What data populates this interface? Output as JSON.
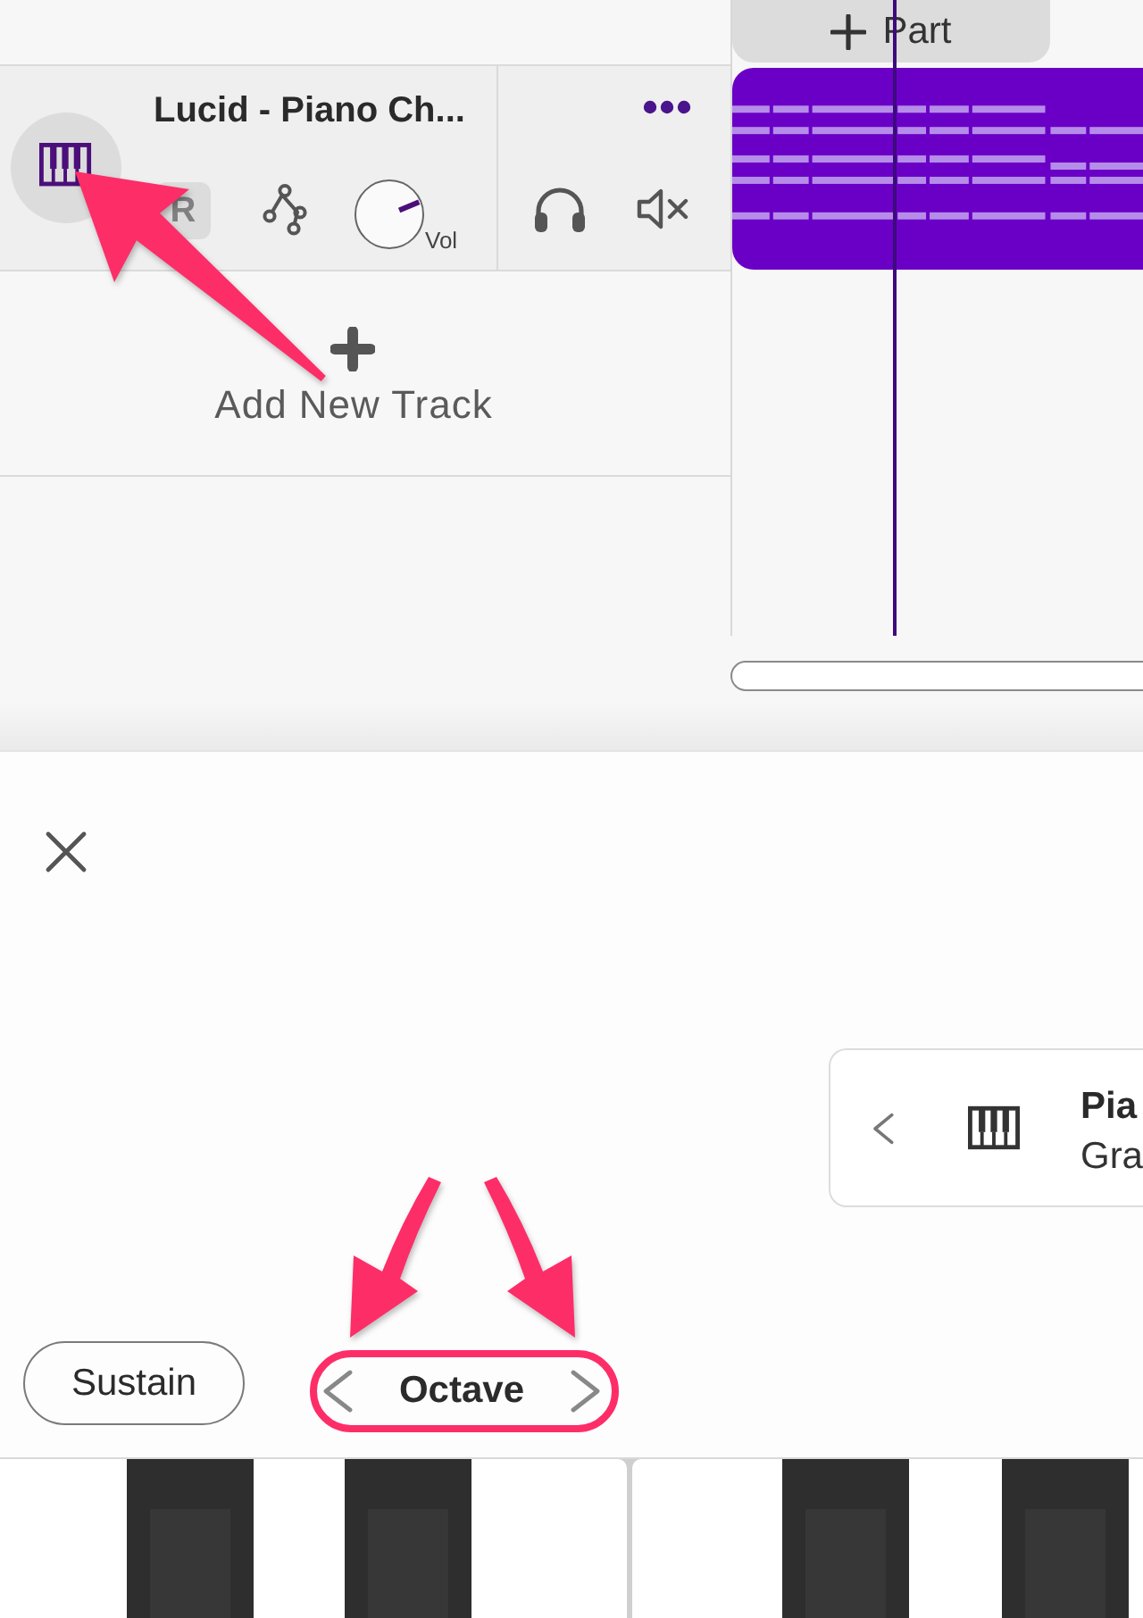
{
  "timeline": {
    "add_part_button": {
      "label": "Part"
    }
  },
  "tracks": [
    {
      "name": "Lucid - Piano Ch...",
      "record_button": {
        "label": "R"
      },
      "volume_knob": {
        "label": "Vol",
        "level": 0.75
      }
    }
  ],
  "add_track_button": {
    "label": "Add New Track"
  },
  "instrument_panel": {
    "instrument_selector": {
      "name": "Pia",
      "subtitle": "Gra"
    },
    "sustain_button": {
      "label": "Sustain"
    },
    "octave_control": {
      "label": "Octave"
    }
  }
}
